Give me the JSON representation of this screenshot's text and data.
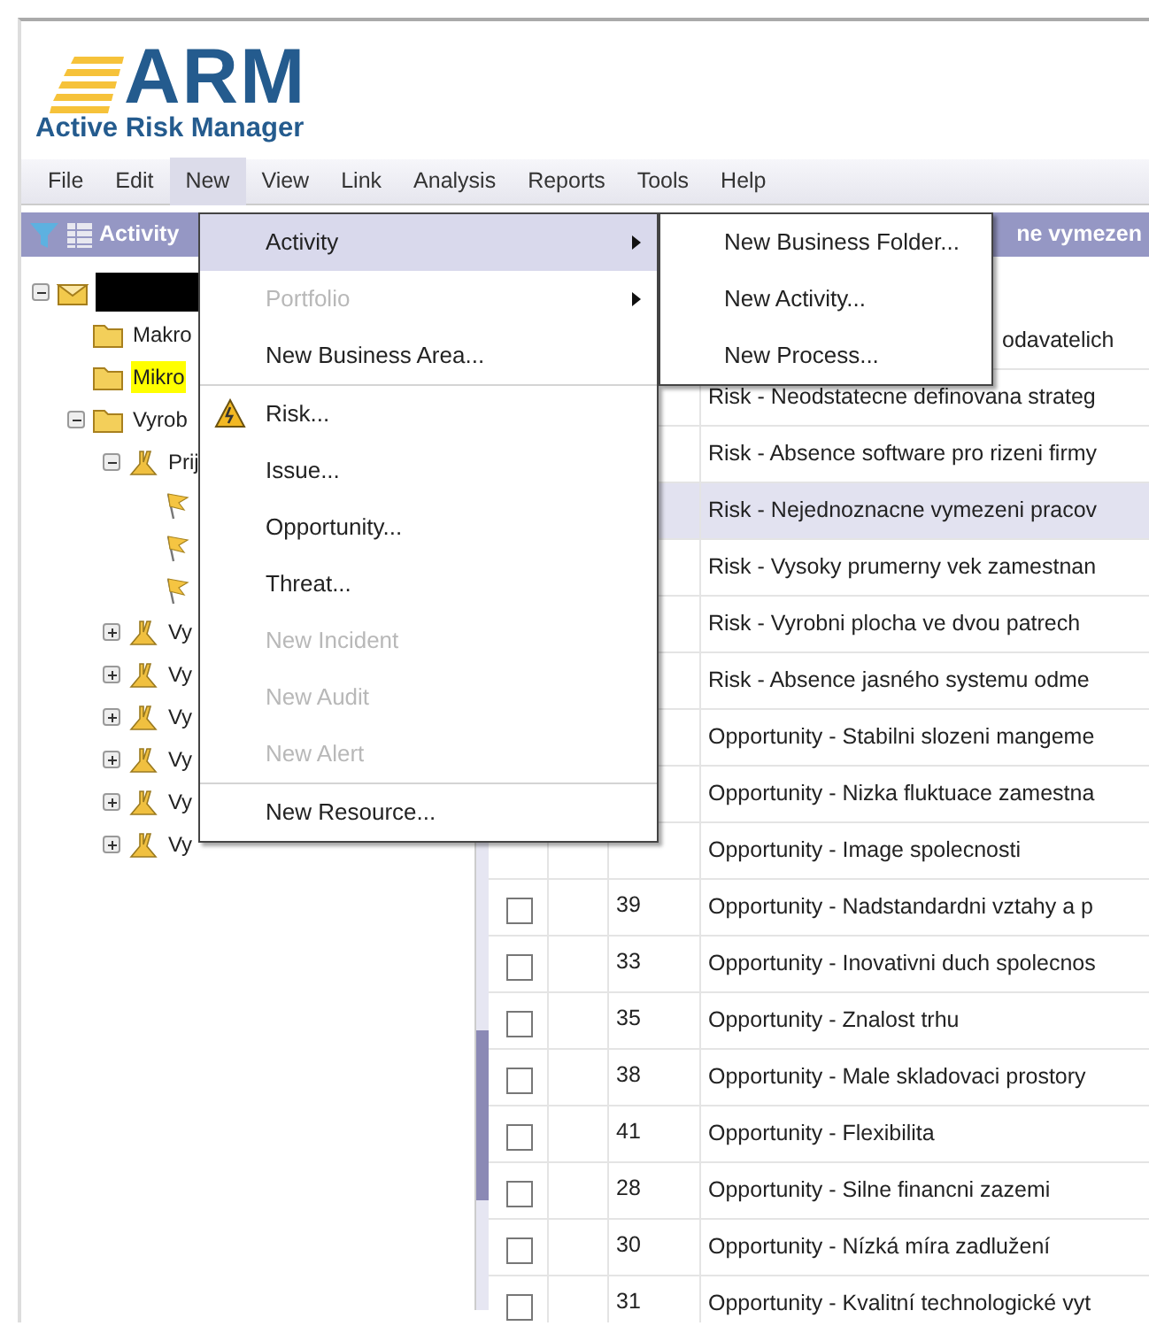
{
  "logo": {
    "mark": "ARM",
    "subtitle": "Active Risk Manager"
  },
  "menubar": [
    {
      "label": "File",
      "selected": false
    },
    {
      "label": "Edit",
      "selected": false
    },
    {
      "label": "New",
      "selected": true
    },
    {
      "label": "View",
      "selected": false
    },
    {
      "label": "Link",
      "selected": false
    },
    {
      "label": "Analysis",
      "selected": false
    },
    {
      "label": "Reports",
      "selected": false
    },
    {
      "label": "Tools",
      "selected": false
    },
    {
      "label": "Help",
      "selected": false
    }
  ],
  "left_panel": {
    "title": "Activity",
    "tree": [
      {
        "kind": "root",
        "redacted": true,
        "expanded": true,
        "children": [
          {
            "kind": "folder",
            "label": "Makro",
            "selected": false
          },
          {
            "kind": "folder",
            "label": "Mikro",
            "selected": true
          },
          {
            "kind": "folder",
            "label": "Vyrob",
            "selected": false,
            "expanded": true,
            "children": [
              {
                "kind": "process",
                "label": "Prij",
                "selected": false,
                "expanded": true,
                "children": [
                  {
                    "kind": "flag"
                  },
                  {
                    "kind": "flag"
                  },
                  {
                    "kind": "flag"
                  }
                ]
              },
              {
                "kind": "process",
                "label": "Vy",
                "selected": false,
                "expanded": false
              },
              {
                "kind": "process",
                "label": "Vy",
                "selected": false,
                "expanded": false
              },
              {
                "kind": "process",
                "label": "Vy",
                "selected": false,
                "expanded": false
              },
              {
                "kind": "process",
                "label": "Vy",
                "selected": false,
                "expanded": false
              },
              {
                "kind": "process",
                "label": "Vy",
                "selected": false,
                "expanded": false
              },
              {
                "kind": "process",
                "label": "Vy",
                "selected": false,
                "expanded": false
              }
            ]
          }
        ]
      }
    ]
  },
  "grid": {
    "header": "ne vymezen",
    "rows": [
      {
        "name": "odavatelich",
        "selected": false
      },
      {
        "name": "Risk - Neodstatecne definovana strateg",
        "selected": false
      },
      {
        "name": "Risk - Absence software pro rizeni firmy",
        "selected": false
      },
      {
        "name": "Risk - Nejednoznacne vymezeni pracov",
        "selected": true
      },
      {
        "name": "Risk - Vysoky prumerny vek zamestnan",
        "selected": false
      },
      {
        "name": "Risk - Vyrobni plocha ve dvou patrech",
        "selected": false
      },
      {
        "name": "Risk - Absence jasného systemu odme",
        "selected": false
      },
      {
        "name": "Opportunity - Stabilni slozeni mangeme",
        "selected": false
      },
      {
        "name": "Opportunity - Nizka fluktuace zamestna",
        "selected": false
      },
      {
        "name": "Opportunity - Image spolecnosti",
        "selected": false
      },
      {
        "id": "39",
        "checked": false,
        "name": "Opportunity - Nadstandardni vztahy a p",
        "selected": false
      },
      {
        "id": "33",
        "checked": false,
        "name": "Opportunity - Inovativni duch spolecnos",
        "selected": false
      },
      {
        "id": "35",
        "checked": false,
        "name": "Opportunity - Znalost trhu",
        "selected": false
      },
      {
        "id": "38",
        "checked": false,
        "name": "Opportunity - Male skladovaci prostory",
        "selected": false
      },
      {
        "id": "41",
        "checked": false,
        "name": "Opportunity - Flexibilita",
        "selected": false
      },
      {
        "id": "28",
        "checked": false,
        "name": "Opportunity - Silne financni zazemi",
        "selected": false
      },
      {
        "id": "30",
        "checked": false,
        "name": "Opportunity - Nízká míra zadlužení",
        "selected": false
      },
      {
        "id": "31",
        "checked": false,
        "name": "Opportunity - Kvalitní technologické vyt",
        "selected": false
      }
    ]
  },
  "new_menu": [
    {
      "kind": "item",
      "label": "Activity",
      "highlighted": true,
      "disabled": false,
      "submenu": true
    },
    {
      "kind": "item",
      "label": "Portfolio",
      "highlighted": false,
      "disabled": true,
      "submenu": true
    },
    {
      "kind": "item",
      "label": "New Business Area...",
      "highlighted": false,
      "disabled": false,
      "submenu": false
    },
    {
      "kind": "separator"
    },
    {
      "kind": "item",
      "label": "Risk...",
      "highlighted": false,
      "disabled": false,
      "submenu": false,
      "has_icon": true
    },
    {
      "kind": "item",
      "label": "Issue...",
      "highlighted": false,
      "disabled": false,
      "submenu": false
    },
    {
      "kind": "item",
      "label": "Opportunity...",
      "highlighted": false,
      "disabled": false,
      "submenu": false
    },
    {
      "kind": "item",
      "label": "Threat...",
      "highlighted": false,
      "disabled": false,
      "submenu": false
    },
    {
      "kind": "item",
      "label": "New Incident",
      "highlighted": false,
      "disabled": true,
      "submenu": false
    },
    {
      "kind": "item",
      "label": "New Audit",
      "highlighted": false,
      "disabled": true,
      "submenu": false
    },
    {
      "kind": "item",
      "label": "New Alert",
      "highlighted": false,
      "disabled": true,
      "submenu": false
    },
    {
      "kind": "separator"
    },
    {
      "kind": "item",
      "label": "New Resource...",
      "highlighted": false,
      "disabled": false,
      "submenu": false
    }
  ],
  "activity_submenu": [
    {
      "label": "New Business Folder..."
    },
    {
      "label": "New Activity..."
    },
    {
      "label": "New Process..."
    }
  ]
}
